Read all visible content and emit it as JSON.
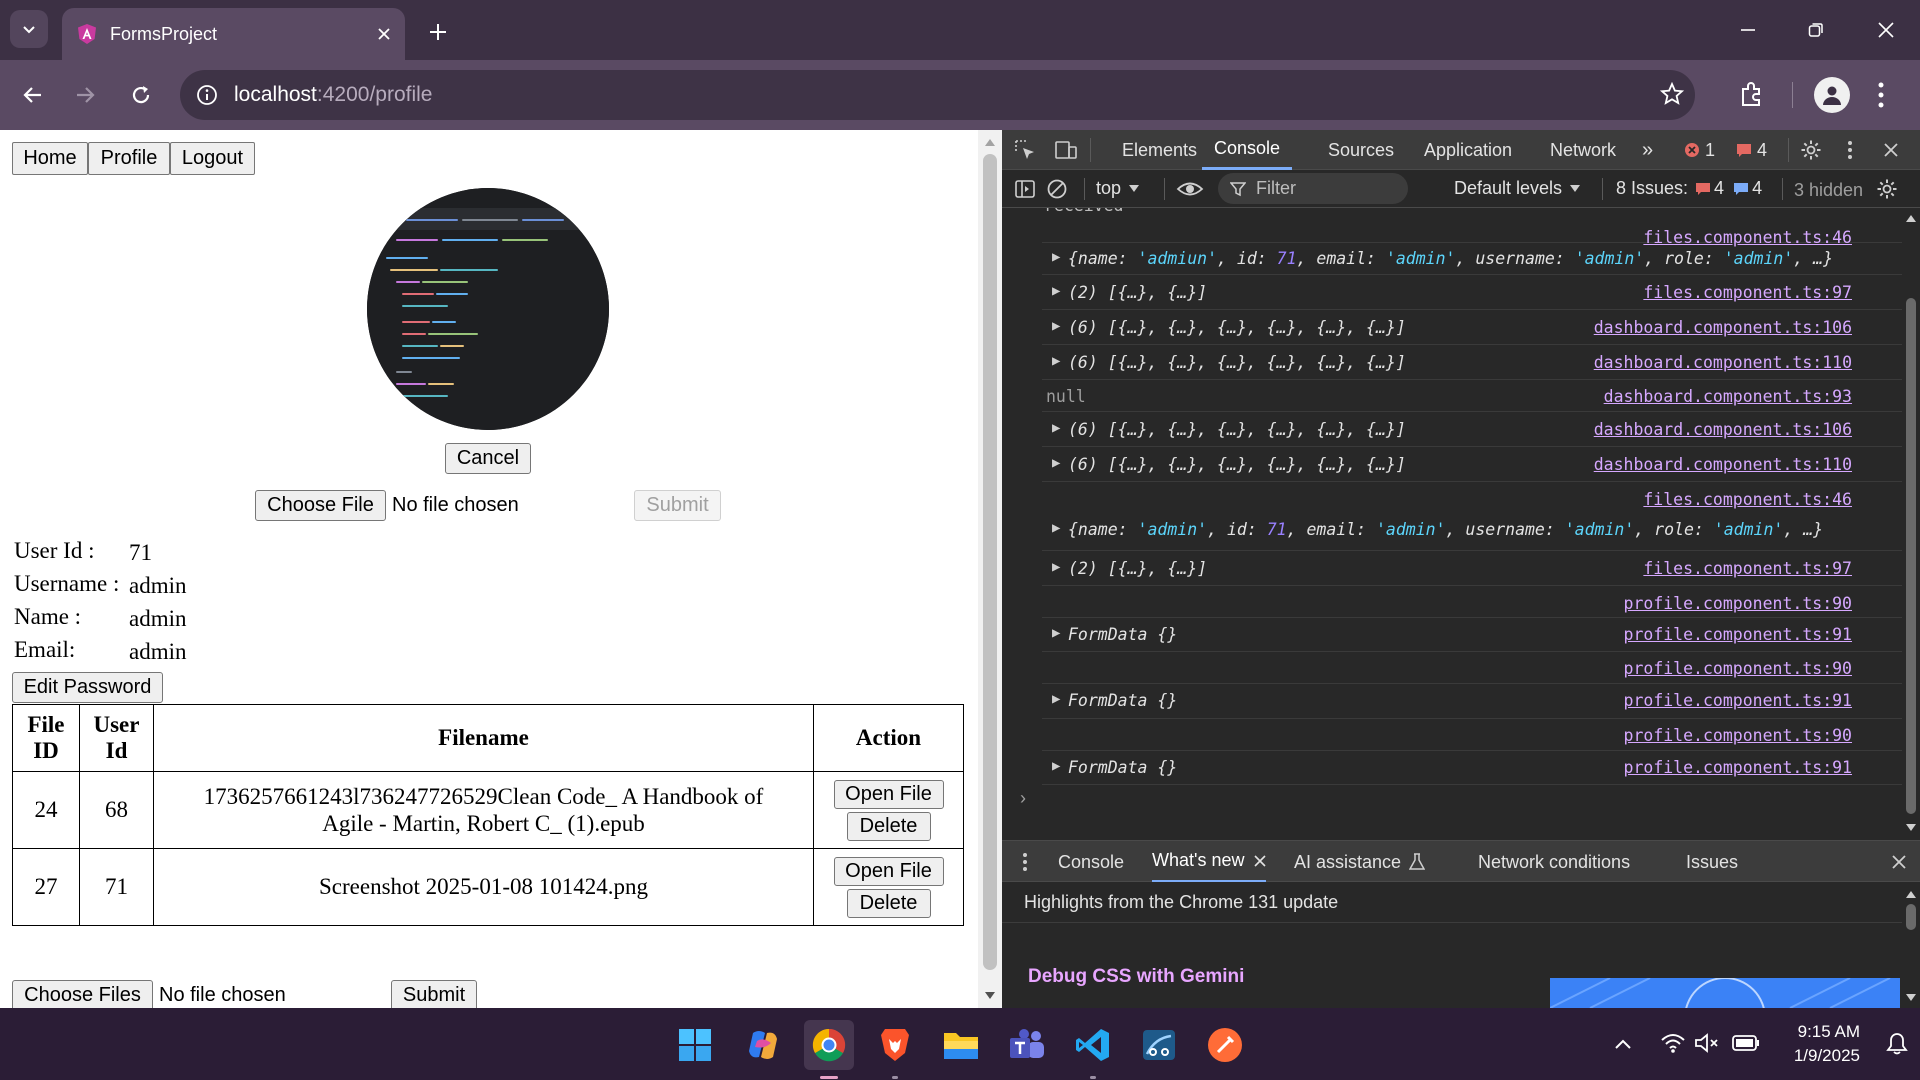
{
  "browser": {
    "tab_title": "FormsProject",
    "url_host": "localhost",
    "url_path": ":4200/profile"
  },
  "nav": {
    "home": "Home",
    "profile": "Profile",
    "logout": "Logout"
  },
  "profile": {
    "cancel": "Cancel",
    "choose_file": "Choose File",
    "no_file": "No file chosen",
    "submit": "Submit",
    "user_id_label": "User Id :",
    "user_id": "71",
    "username_label": "Username :",
    "username": "admin",
    "name_label": "Name :",
    "name": "admin",
    "email_label": "Email:",
    "email": "admin",
    "edit_password": "Edit Password"
  },
  "files_table": {
    "headers": [
      "File ID",
      "User Id",
      "Filename",
      "Action"
    ],
    "header_file_id_1": "File",
    "header_file_id_2": "ID",
    "header_user_id_1": "User",
    "header_user_id_2": "Id",
    "rows": [
      {
        "file_id": "24",
        "user_id": "68",
        "filename": "1736257661243l736247726529Clean Code_ A Handbook of Agile - Martin, Robert C_ (1).epub"
      },
      {
        "file_id": "27",
        "user_id": "71",
        "filename": "Screenshot 2025-01-08 101424.png"
      }
    ],
    "open_label": "Open File",
    "delete_label": "Delete"
  },
  "bottom_upload": {
    "choose_files": "Choose Files",
    "no_file": "No file chosen",
    "submit": "Submit"
  },
  "devtools": {
    "tabs": [
      "Elements",
      "Console",
      "Sources",
      "Application",
      "Network"
    ],
    "active_tab": "Console",
    "error_count": "1",
    "warning_count": "4",
    "context": "top",
    "filter_placeholder": "Filter",
    "levels": "Default levels",
    "issues_label": "8 Issues:",
    "issues_errors": "4",
    "issues_info": "4",
    "hidden": "3 hidden",
    "console": [
      {
        "link": "files.component.ts:46",
        "text": "",
        "obj": null
      },
      {
        "link": "",
        "text": "",
        "obj": {
          "name": "'admiun'",
          "id": "71",
          "email": "'admin'",
          "username": "'admin'",
          "role": "'admin'"
        }
      },
      {
        "link": "files.component.ts:97",
        "text": "(2) [{…}, {…}]"
      },
      {
        "link": "dashboard.component.ts:106",
        "text": "(6) [{…}, {…}, {…}, {…}, {…}, {…}]"
      },
      {
        "link": "dashboard.component.ts:110",
        "text": "(6) [{…}, {…}, {…}, {…}, {…}, {…}]"
      },
      {
        "link": "dashboard.component.ts:93",
        "text": "null"
      },
      {
        "link": "dashboard.component.ts:106",
        "text": "(6) [{…}, {…}, {…}, {…}, {…}, {…}]"
      },
      {
        "link": "dashboard.component.ts:110",
        "text": "(6) [{…}, {…}, {…}, {…}, {…}, {…}]"
      },
      {
        "link": "files.component.ts:46",
        "text": ""
      },
      {
        "link": "",
        "obj": {
          "name": "'admin'",
          "id": "71",
          "email": "'admin'",
          "username": "'admin'",
          "role": "'admin'"
        }
      },
      {
        "link": "files.component.ts:97",
        "text": "(2) [{…}, {…}]"
      },
      {
        "link": "profile.component.ts:90",
        "text": ""
      },
      {
        "link": "profile.component.ts:91",
        "text": "FormData {}"
      },
      {
        "link": "profile.component.ts:90",
        "text": ""
      },
      {
        "link": "profile.component.ts:91",
        "text": "FormData {}"
      },
      {
        "link": "profile.component.ts:90",
        "text": ""
      },
      {
        "link": "profile.component.ts:91",
        "text": "FormData {}"
      }
    ],
    "top_fragment": "received",
    "drawer_tabs": [
      "Console",
      "What's new",
      "AI assistance",
      "Network conditions",
      "Issues"
    ],
    "drawer_active": "What's new",
    "whatsnew_heading": "Highlights from the Chrome 131 update",
    "whatsnew_item": "Debug CSS with Gemini"
  },
  "taskbar": {
    "time": "9:15 AM",
    "date": "1/9/2025"
  },
  "colors": {
    "accent": "#7cacf8",
    "link": "#d6a8ff",
    "string": "#5cd5fb",
    "number": "#9980ff",
    "error": "#e46962",
    "frame": "#3c3044"
  }
}
